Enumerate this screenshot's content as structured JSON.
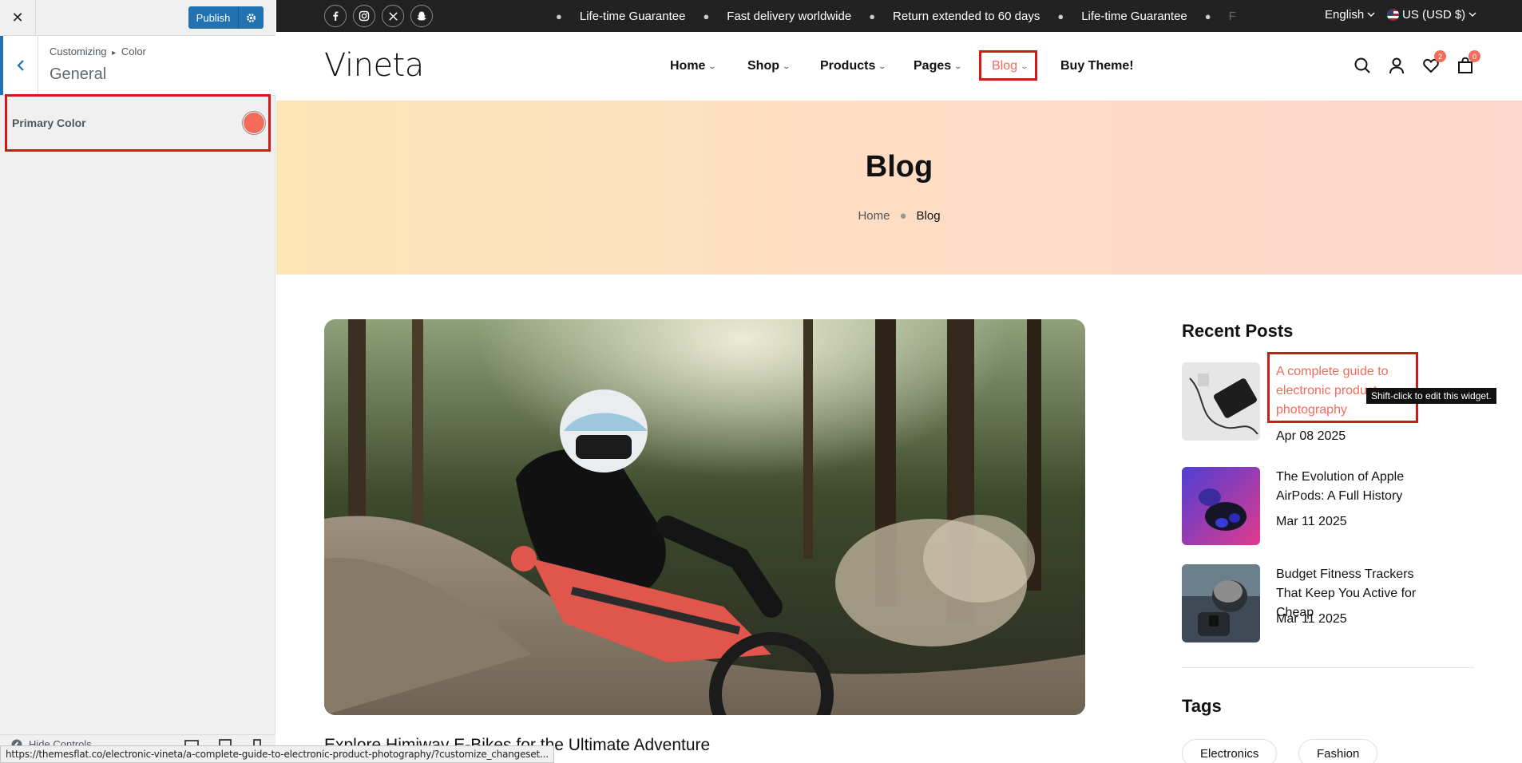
{
  "customizer": {
    "close_label": "✕",
    "publish_label": "Publish",
    "breadcrumb_parent": "Customizing",
    "breadcrumb_sep": "▸",
    "breadcrumb_current": "Color",
    "section_title": "General",
    "primary_color_label": "Primary Color",
    "primary_color_value": "#f26b5b",
    "hide_controls_label": "Hide Controls",
    "status_url": "https://themesflat.co/electronic-vineta/a-complete-guide-to-electronic-product-photography/?customize_changeset..."
  },
  "topbar": {
    "socials": [
      "facebook-icon",
      "instagram-icon",
      "x-icon",
      "snapchat-icon"
    ],
    "marquee": [
      "Life-time Guarantee",
      "Fast delivery worldwide",
      "Return extended to 60 days",
      "Life-time Guarantee",
      "F"
    ],
    "language": "English",
    "currency": "US (USD $)"
  },
  "header": {
    "logo": "Vineta",
    "nav": {
      "home": "Home",
      "shop": "Shop",
      "products": "Products",
      "pages": "Pages",
      "blog": "Blog",
      "buy": "Buy Theme!"
    },
    "wishlist_count": "2",
    "cart_count": "0"
  },
  "hero": {
    "title": "Blog",
    "crumb_home": "Home",
    "crumb_current": "Blog"
  },
  "post": {
    "title": "Explore Himiway E-Bikes for the Ultimate Adventure"
  },
  "sidebar_widgets": {
    "recent_title": "Recent Posts",
    "recent_posts": [
      {
        "title": "A complete guide to electronic product photography",
        "date": "Apr 08 2025"
      },
      {
        "title": "The Evolution of Apple AirPods: A Full History",
        "date": "Mar 11 2025"
      },
      {
        "title": "Budget Fitness Trackers That Keep You Active for Cheap",
        "date": "Mar 11 2025"
      }
    ],
    "tooltip": "Shift-click to edit this widget.",
    "tags_title": "Tags",
    "tags": [
      "Electronics",
      "Fashion"
    ]
  },
  "colors": {
    "accent": "#f26b5b",
    "wp_blue": "#2271b1",
    "highlight": "#d01a1a"
  }
}
